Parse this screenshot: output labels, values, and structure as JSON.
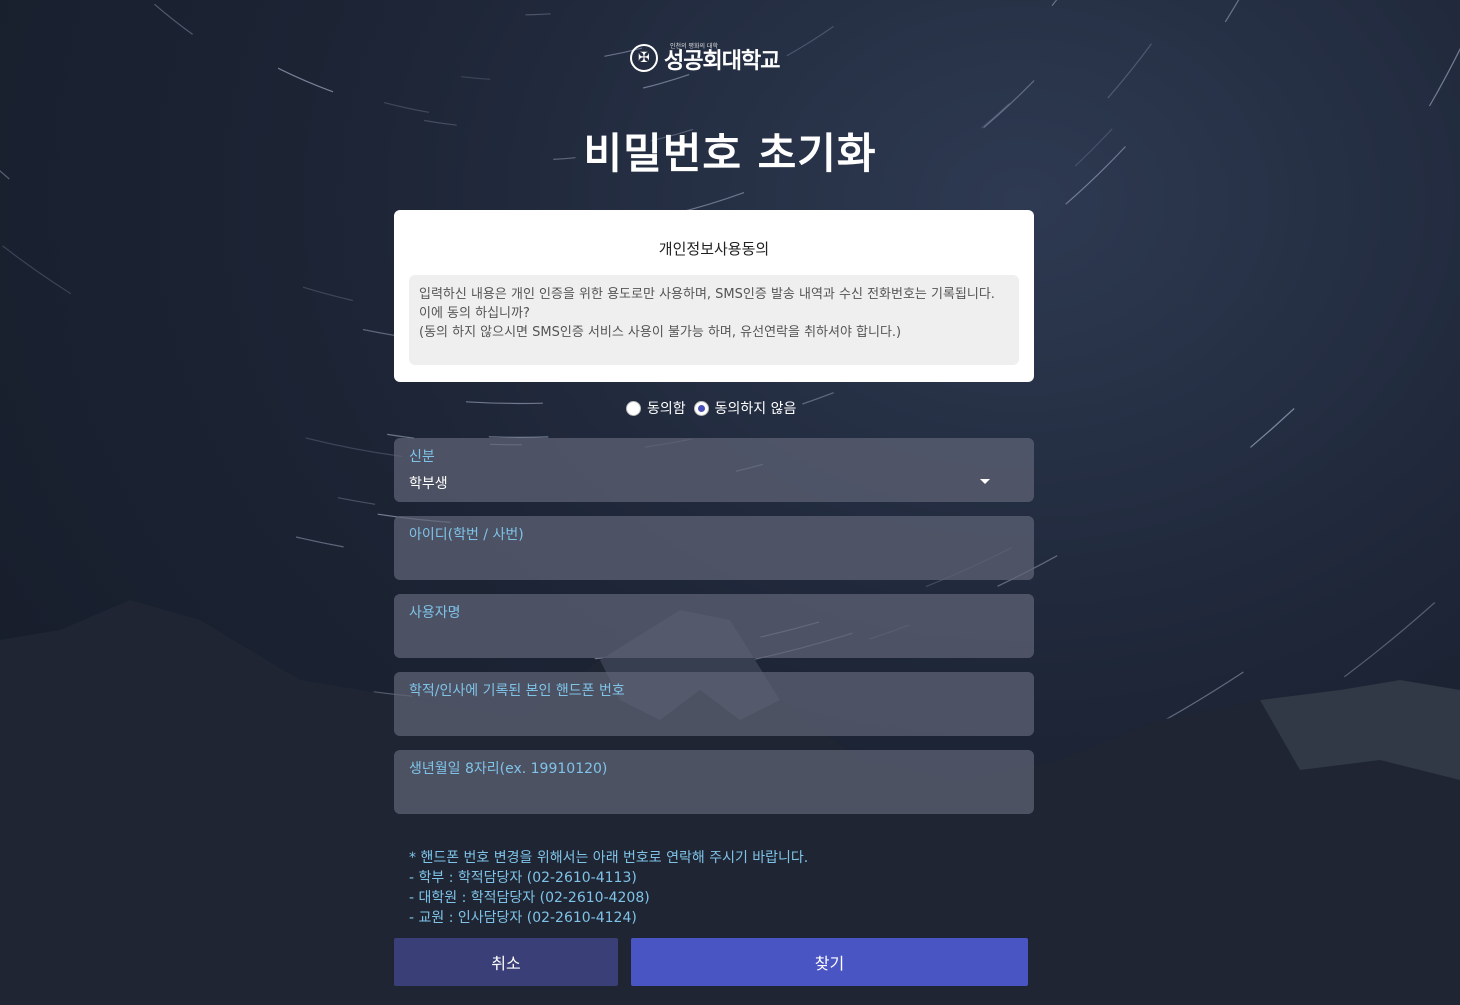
{
  "logo": {
    "emblem_icon": "university-seal-icon",
    "tagline": "인천의 평화의 대학",
    "name": "성공회대학교"
  },
  "page_title": "비밀번호 초기화",
  "consent": {
    "title": "개인정보사용동의",
    "line1": "입력하신 내용은 개인 인증을 위한 용도로만 사용하며, SMS인증 발송 내역과 수신 전화번호는 기록됩니다. 이에 동의 하십니까?",
    "line2": "(동의 하지 않으시면 SMS인증 서비스 사용이 불가능 하며, 유선연락을 취하셔야 합니다.)",
    "agree_label": "동의함",
    "disagree_label": "동의하지 않음",
    "selected": "disagree"
  },
  "form": {
    "role": {
      "label": "신분",
      "value": "학부생"
    },
    "user_id": {
      "label": "아이디(학번 / 사번)",
      "value": ""
    },
    "user_name": {
      "label": "사용자명",
      "value": ""
    },
    "phone": {
      "label": "학적/인사에 기록된 본인 핸드폰 번호",
      "value": ""
    },
    "birth": {
      "label": "생년월일 8자리(ex. 19910120)",
      "value": ""
    }
  },
  "notice": {
    "heading": "* 핸드폰 번호 변경을 위해서는 아래 번호로 연락해 주시기 바랍니다.",
    "lines": [
      "- 학부 : 학적담당자 (02-2610-4113)",
      "- 대학원 : 학적담당자 (02-2610-4208)",
      "- 교원 : 인사담당자 (02-2610-4124)"
    ]
  },
  "buttons": {
    "cancel": "취소",
    "find": "찾기"
  },
  "colors": {
    "accent": "#4a55c4",
    "cancel": "#3a3f78",
    "label": "#7fc3e8"
  }
}
